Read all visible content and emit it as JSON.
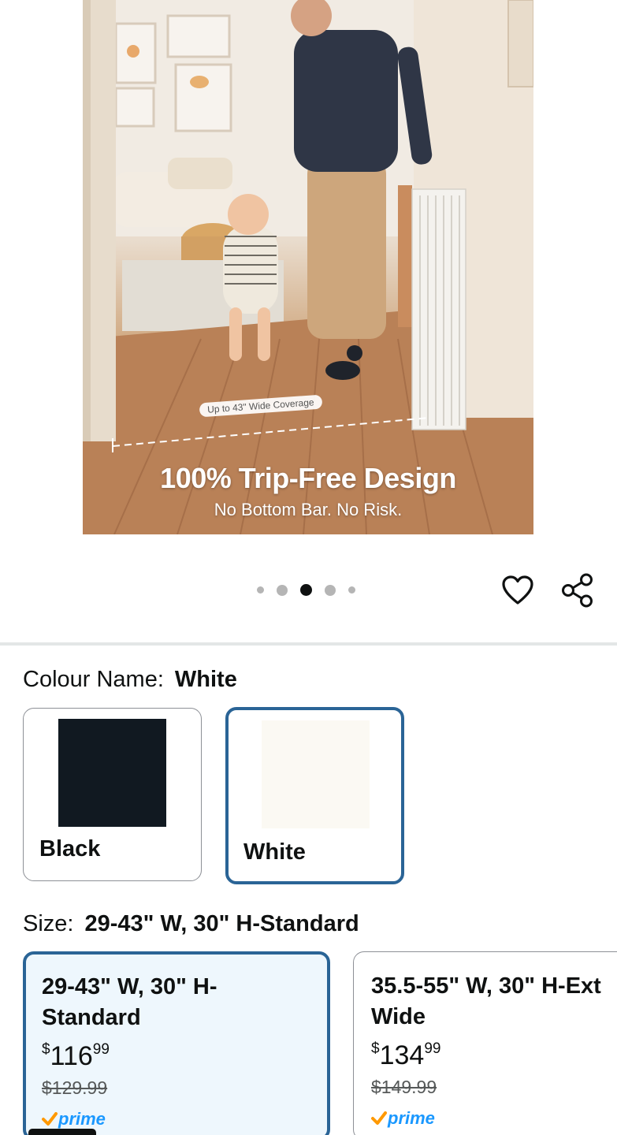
{
  "hero": {
    "headline": "100% Trip-Free Design",
    "subheadline": "No Bottom Bar. No Risk.",
    "coverage_note": "Up to 43\" Wide Coverage"
  },
  "carousel": {
    "total_images": 5,
    "active_index": 2
  },
  "actions": {
    "wishlist_icon": "heart-outline-icon",
    "share_icon": "share-icon"
  },
  "colour": {
    "label": "Colour Name:",
    "selected": "White",
    "options": [
      {
        "name": "Black",
        "swatch_color": "#111921"
      },
      {
        "name": "White",
        "swatch_color": "#fbf9f3"
      }
    ]
  },
  "size": {
    "label": "Size:",
    "selected": "29-43\" W, 30\" H-Standard",
    "options": [
      {
        "title_line1": "29-43\" W, 30\" H-",
        "title_line2": "Standard",
        "currency": "$",
        "price_whole": "116",
        "price_cents": "99",
        "was_price": "$129.99",
        "prime": "prime"
      },
      {
        "title_line1": "35.5-55\" W, 30\" H-Ext",
        "title_line2": "Wide",
        "currency": "$",
        "price_whole": "134",
        "price_cents": "99",
        "was_price": "$149.99",
        "prime": "prime"
      }
    ]
  },
  "colors": {
    "selected_border": "#2a6496",
    "selected_fill": "#eef7fd",
    "prime_blue": "#1a98ff",
    "prime_check": "#ff9900"
  }
}
